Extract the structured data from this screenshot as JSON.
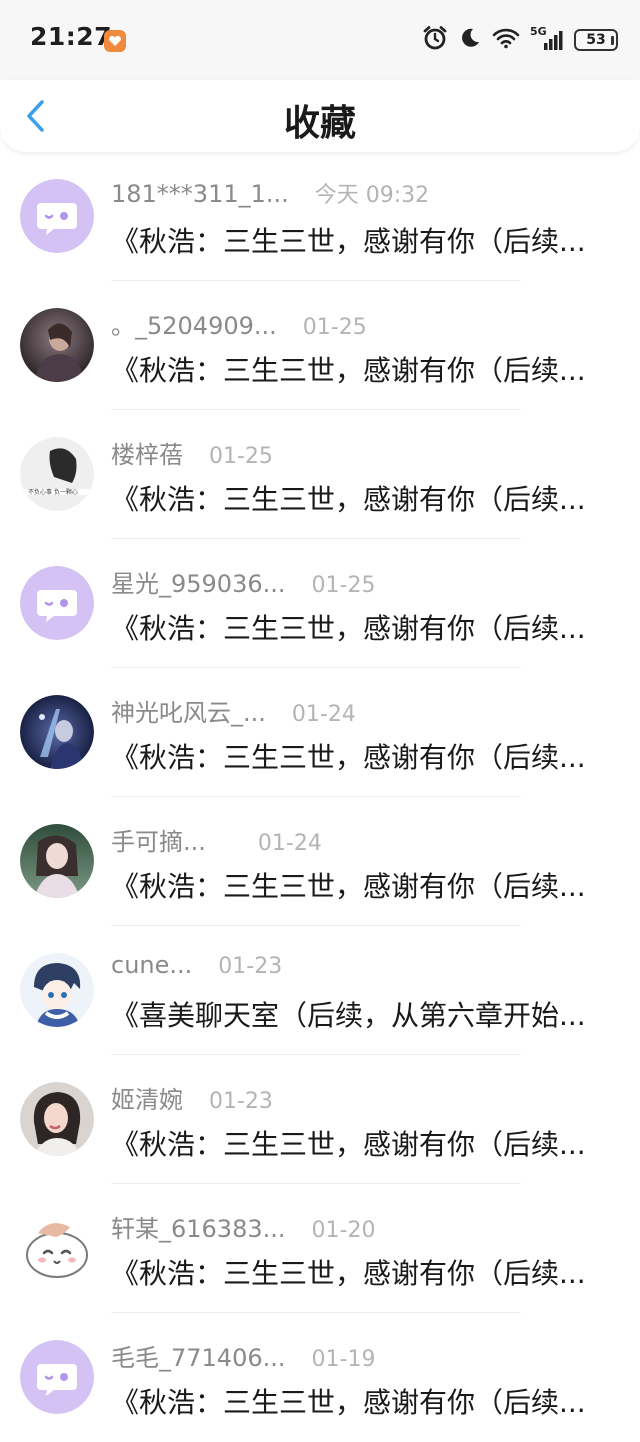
{
  "status_bar": {
    "time": "21:27",
    "network": "5G",
    "battery": "53",
    "icons": [
      "app-badge-icon",
      "alarm-icon",
      "moon-icon",
      "wifi-icon",
      "signal-icon",
      "battery-icon"
    ]
  },
  "header": {
    "title": "收藏",
    "back_icon": "chevron-left-icon"
  },
  "colors": {
    "back": "#3aa1e8",
    "bubble_bg": "#d3c2f3",
    "bubble_fg": "#b195ea"
  },
  "items": [
    {
      "name": "181***311_1...",
      "time": "今天 09:32",
      "content": "《秋浩：三生三世，感谢有你（后续...",
      "avatar": "bubble"
    },
    {
      "name": "。_5204909...",
      "time": "01-25",
      "content": "《秋浩：三生三世，感谢有你（后续...",
      "avatar": "photo-dark"
    },
    {
      "name": "楼梓蓓",
      "time": "01-25",
      "content": "《秋浩：三生三世，感谢有你（后续...",
      "avatar": "photo-light"
    },
    {
      "name": "星光_959036...",
      "time": "01-25",
      "content": "《秋浩：三生三世，感谢有你（后续...",
      "avatar": "bubble"
    },
    {
      "name": "神光叱风云_...",
      "time": "01-24",
      "content": "《秋浩：三生三世，感谢有你（后续...",
      "avatar": "photo-blue"
    },
    {
      "name": "手可摘...",
      "time": "01-24",
      "content": "《秋浩：三生三世，感谢有你（后续...",
      "avatar": "photo-green"
    },
    {
      "name": "cune...",
      "time": "01-23",
      "content": "《喜美聊天室（后续，从第六章开始...",
      "avatar": "anime"
    },
    {
      "name": "姬清婉",
      "time": "01-23",
      "content": "《秋浩：三生三世，感谢有你（后续...",
      "avatar": "photo-warm"
    },
    {
      "name": "轩某_616383...",
      "time": "01-20",
      "content": "《秋浩：三生三世，感谢有你（后续...",
      "avatar": "cartoon"
    },
    {
      "name": "毛毛_771406...",
      "time": "01-19",
      "content": "《秋浩：三生三世，感谢有你（后续...",
      "avatar": "bubble"
    }
  ]
}
